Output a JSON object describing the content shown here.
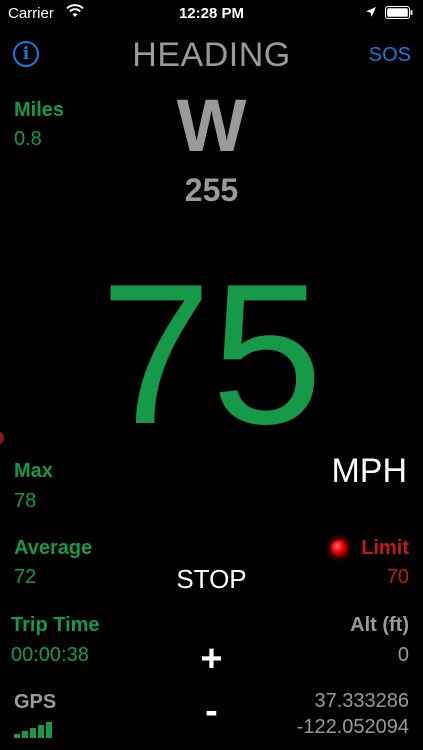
{
  "status_bar": {
    "carrier": "Carrier",
    "time": "12:28 PM",
    "icons": [
      "wifi-icon",
      "location-arrow-icon",
      "battery-icon"
    ]
  },
  "header": {
    "info_icon_label": "i",
    "title": "HEADING",
    "sos_label": "SOS"
  },
  "heading": {
    "direction": "W",
    "degrees": "255"
  },
  "miles": {
    "label": "Miles",
    "value": "0.8"
  },
  "speed": {
    "value": "75",
    "unit": "MPH"
  },
  "max": {
    "label": "Max",
    "value": "78"
  },
  "average": {
    "label": "Average",
    "value": "72"
  },
  "controls": {
    "stop_label": "STOP",
    "plus_label": "+",
    "minus_label": "-"
  },
  "limit": {
    "label": "Limit",
    "value": "70"
  },
  "trip_time": {
    "label": "Trip Time",
    "value": "00:00:38"
  },
  "altitude": {
    "label": "Alt (ft)",
    "value": "0"
  },
  "gps": {
    "label": "GPS",
    "latitude": "37.333286",
    "longitude": "-122.052094",
    "signal_bars": 5
  },
  "colors": {
    "accent_blue": "#1a7bdc",
    "green": "#169a4a",
    "gray": "#9a9a9a",
    "limit_red": "#c11a1a",
    "background": "#000000"
  }
}
